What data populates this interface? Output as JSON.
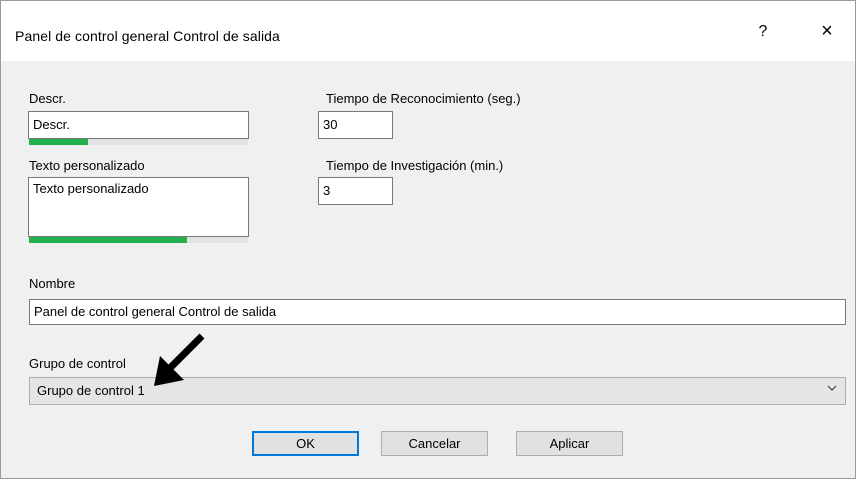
{
  "window": {
    "title": "Panel de control general Control de salida",
    "help_label": "?",
    "close_label": "×"
  },
  "descr": {
    "label": "Descr.",
    "value": "Descr.",
    "usage_fraction": 0.27
  },
  "custom_text": {
    "label": "Texto personalizado",
    "value": "Texto personalizado",
    "usage_fraction": 0.72
  },
  "ack_time": {
    "label": "Tiempo de Reconocimiento (seg.)",
    "value": "30"
  },
  "investigation_time": {
    "label": "Tiempo de Investigación (min.)",
    "value": "3"
  },
  "name": {
    "label": "Nombre",
    "value": "Panel de control general Control de salida"
  },
  "control_group": {
    "label": "Grupo de control",
    "selected": "Grupo de control 1"
  },
  "buttons": {
    "ok": "OK",
    "cancel": "Cancelar",
    "apply": "Aplicar"
  },
  "colors": {
    "meter_fill": "#22b14c",
    "default_button_border": "#0078d7"
  }
}
